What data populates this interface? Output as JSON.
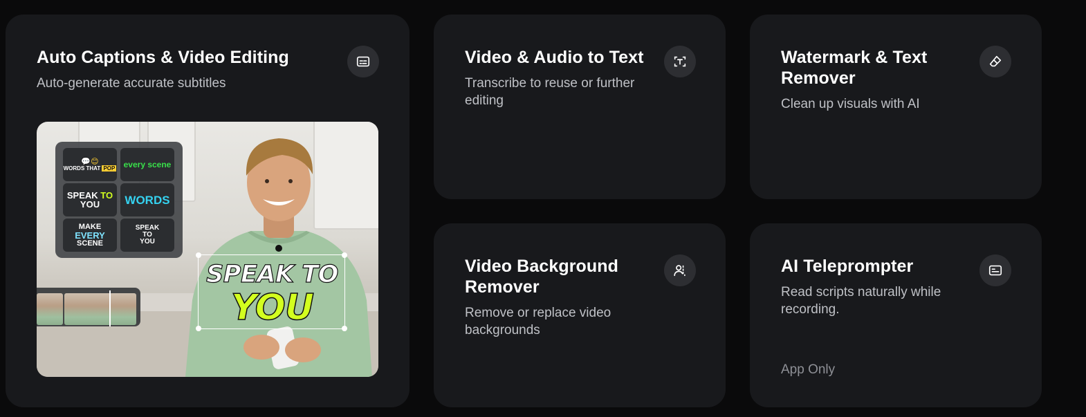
{
  "cards": {
    "auto_captions": {
      "title": "Auto Captions & Video Editing",
      "subtitle": "Auto-generate accurate subtitles",
      "icon": "subtitles-icon",
      "preview": {
        "tiles": [
          {
            "line1": "WORDS THAT",
            "line2": "POP",
            "emoji": "💬😊"
          },
          {
            "text": "every scene"
          },
          {
            "line1": "SPEAK",
            "accent": "TO",
            "line2": "YOU"
          },
          {
            "text": "WORDS"
          },
          {
            "line1": "MAKE",
            "accent": "EVERY",
            "line2": "SCENE"
          },
          {
            "line1": "SPEAK",
            "line2": "TO",
            "line3": "YOU"
          }
        ],
        "caption_top": "SPEAK TO",
        "caption_bottom": "YOU"
      }
    },
    "video_audio_text": {
      "title": "Video & Audio to Text",
      "subtitle": "Transcribe to reuse or further editing",
      "icon": "text-recognition-icon"
    },
    "watermark_remover": {
      "title": "Watermark & Text Remover",
      "subtitle": "Clean up visuals with AI",
      "icon": "eraser-icon"
    },
    "background_remover": {
      "title": "Video Background Remover",
      "subtitle": "Remove or replace video backgrounds",
      "icon": "person-cutout-icon"
    },
    "teleprompter": {
      "title": "AI Teleprompter",
      "subtitle": "Read scripts naturally while recording.",
      "note": "App Only",
      "icon": "teleprompter-icon"
    }
  },
  "colors": {
    "page_bg": "#0a0a0b",
    "card_bg": "#18191c",
    "icon_bg": "#2d2e32",
    "caption_accent": "#d3ff1f"
  }
}
